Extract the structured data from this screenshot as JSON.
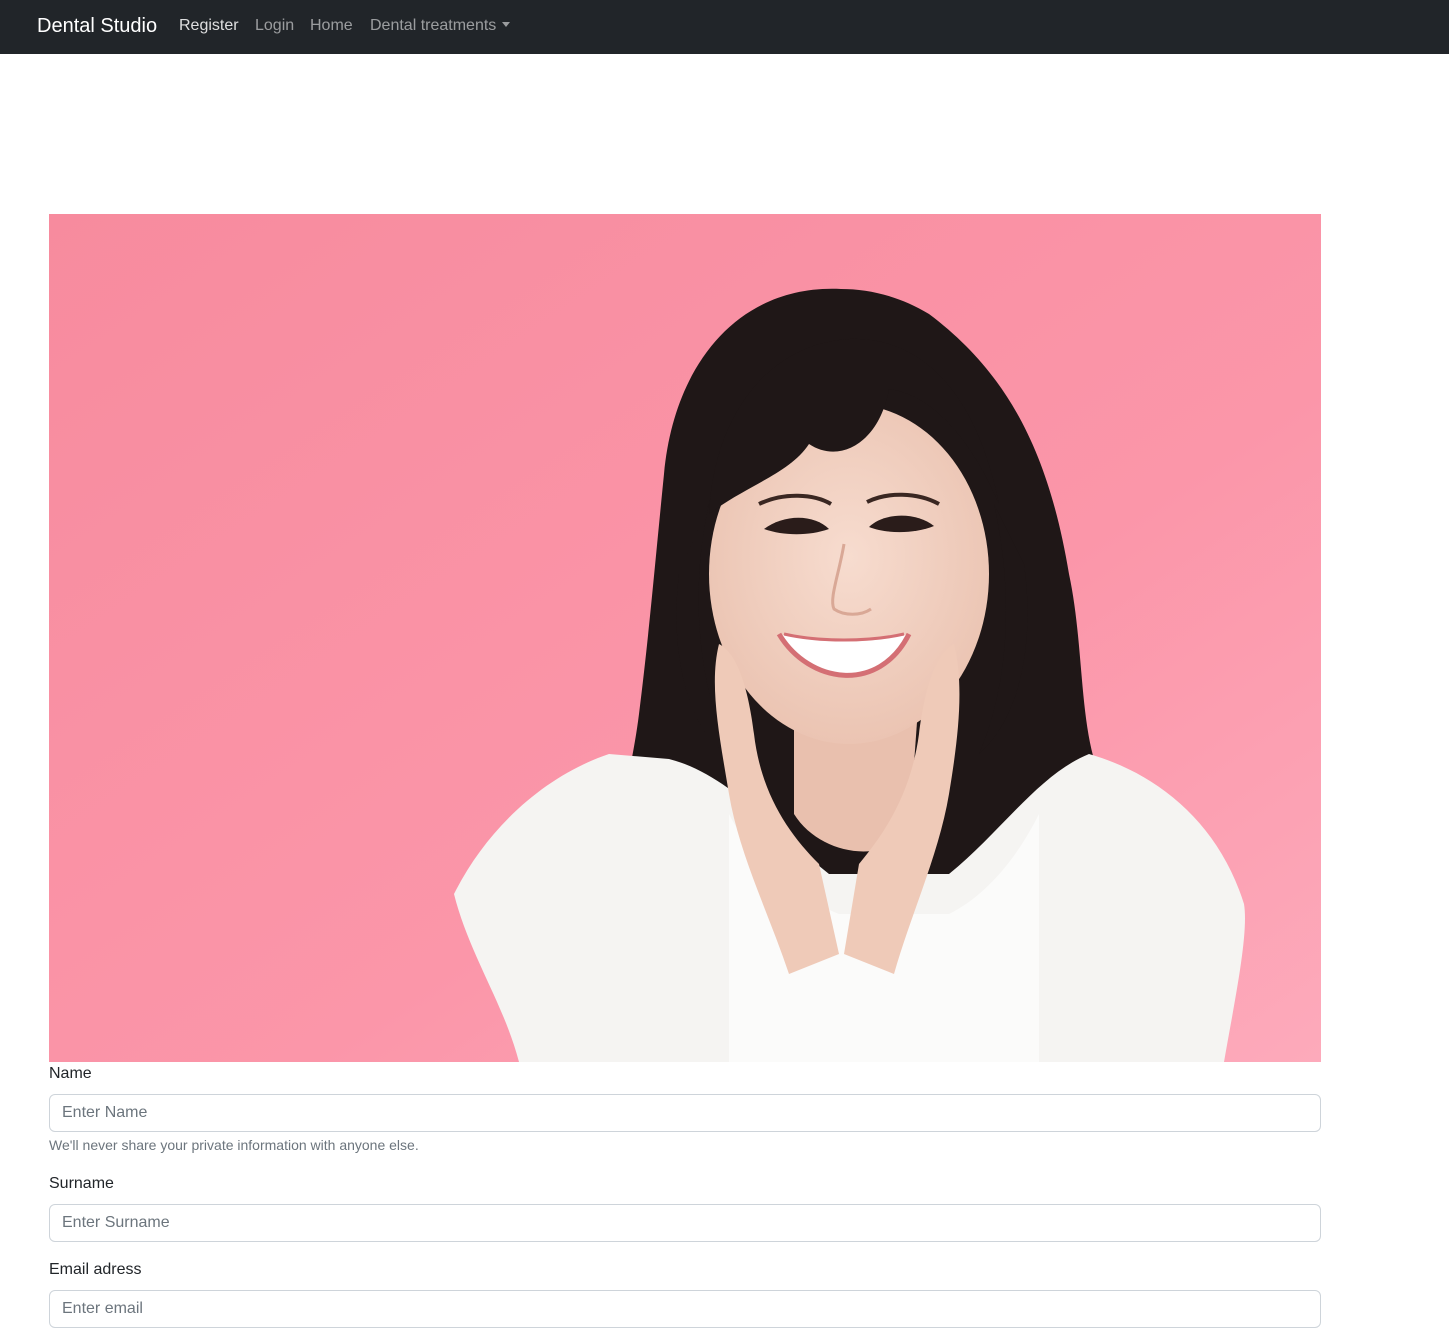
{
  "navbar": {
    "brand": "Dental Studio",
    "links": [
      {
        "label": "Register",
        "active": true
      },
      {
        "label": "Login"
      },
      {
        "label": "Home"
      },
      {
        "label": "Dental treatments",
        "dropdown": true
      }
    ],
    "background_color": "#212529"
  },
  "hero": {
    "image": "smiling-woman-photo",
    "background_color": "#f98fa2"
  },
  "form": {
    "name": {
      "label": "Name",
      "placeholder": "Enter Name",
      "help_text": "We'll never share your private information with anyone else."
    },
    "surname": {
      "label": "Surname",
      "placeholder": "Enter Surname"
    },
    "email": {
      "label": "Email adress",
      "placeholder": "Enter email"
    }
  }
}
